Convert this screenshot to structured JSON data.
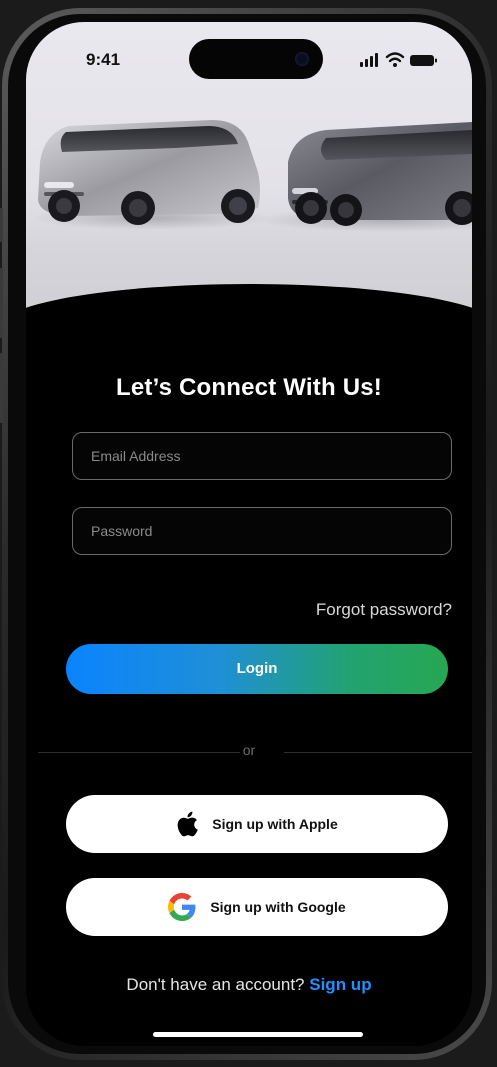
{
  "status_bar": {
    "time": "9:41",
    "icons": [
      "signal-icon",
      "wifi-icon",
      "battery-icon"
    ]
  },
  "hero": {
    "image": "two-vans-image"
  },
  "title": "Let’s Connect With Us!",
  "form": {
    "email_placeholder": "Email Address",
    "password_placeholder": "Password",
    "forgot_label": "Forgot password?",
    "login_label": "Login"
  },
  "divider": {
    "label": "or"
  },
  "social": {
    "apple_label": "Sign up with Apple",
    "google_label": "Sign up with Google"
  },
  "footer": {
    "prompt": "Don't have an account?",
    "signup_label": "Sign up"
  },
  "colors": {
    "background": "#000000",
    "accent_link": "#1e90ff",
    "gradient_start": "#0a84ff",
    "gradient_end": "#27a752"
  }
}
